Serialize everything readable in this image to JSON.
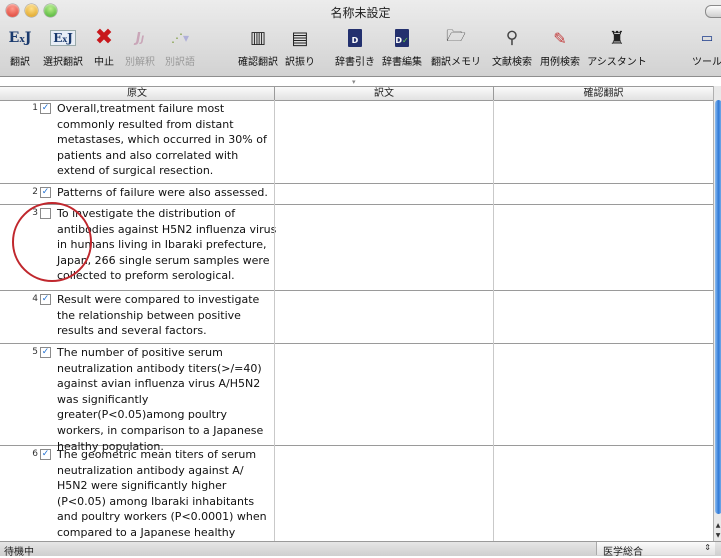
{
  "window": {
    "title": "名称未設定"
  },
  "toolbar": {
    "items": [
      {
        "id": "translate",
        "label": "翻訳",
        "icon": "ej-icon",
        "enabled": true
      },
      {
        "id": "translate-selection",
        "label": "選択翻訳",
        "icon": "ej-selection-icon",
        "enabled": true
      },
      {
        "id": "stop",
        "label": "中止",
        "icon": "stop-x-icon",
        "enabled": true
      },
      {
        "id": "alt-translation",
        "label": "別解釈",
        "icon": "alt-translation-icon",
        "enabled": false
      },
      {
        "id": "alt-word",
        "label": "別訳語",
        "icon": "alt-word-icon",
        "enabled": false
      },
      {
        "id": "check-translation",
        "label": "確認翻訳",
        "icon": "columns-icon",
        "enabled": true
      },
      {
        "id": "assign-translation",
        "label": "訳振り",
        "icon": "lines-icon",
        "enabled": true
      },
      {
        "id": "dict-lookup",
        "label": "辞書引き",
        "icon": "dictionary-icon",
        "enabled": true
      },
      {
        "id": "dict-edit",
        "label": "辞書編集",
        "icon": "dictionary-edit-icon",
        "enabled": true
      },
      {
        "id": "memo",
        "label": "翻訳メモリ",
        "icon": "memory-icon",
        "enabled": true
      },
      {
        "id": "lit-search",
        "label": "文献検索",
        "icon": "magnifier-icon",
        "enabled": true
      },
      {
        "id": "example-search",
        "label": "用例検索",
        "icon": "example-icon",
        "enabled": true
      },
      {
        "id": "assistant",
        "label": "アシスタント",
        "icon": "assistant-icon",
        "enabled": true
      },
      {
        "id": "tools",
        "label": "ツール",
        "icon": "tools-icon",
        "enabled": true
      }
    ]
  },
  "columns": {
    "source": "原文",
    "target": "訳文",
    "check": "確認翻訳"
  },
  "rows": [
    {
      "num": "1",
      "checked": true,
      "text": "Overall,treatment failure most commonly resulted from distant metastases, which occurred in 30% of patients and also correlated with extend of surgical resection."
    },
    {
      "num": "2",
      "checked": true,
      "text": "Patterns of failure were also assessed."
    },
    {
      "num": "3",
      "checked": false,
      "text": "To investigate the distribution of antibodies against H5N2 influenza virus in humans living in Ibaraki prefecture, Japan, 266 single serum samples were collected to preform serological."
    },
    {
      "num": "4",
      "checked": true,
      "text": "Result were compared to investigate the relationship between positive results and several factors."
    },
    {
      "num": "5",
      "checked": true,
      "text": "The number of positive serum neutralization antibody titers(>/=40) against avian influenza virus A/H5N2 was significantly greater(P<0.05)among poultry workers, in comparison to a Japanese healthy population."
    },
    {
      "num": "6",
      "checked": true,
      "text": "The geometric mean titers of serum neutralization antibody against A/ H5N2 were significantly higher (P<0.05) among Ibaraki inhabitants and poultry workers (P<0.0001) when compared to a Japanese healthy population."
    }
  ],
  "status": {
    "text": "待機中",
    "dictionary": "医学総合"
  }
}
